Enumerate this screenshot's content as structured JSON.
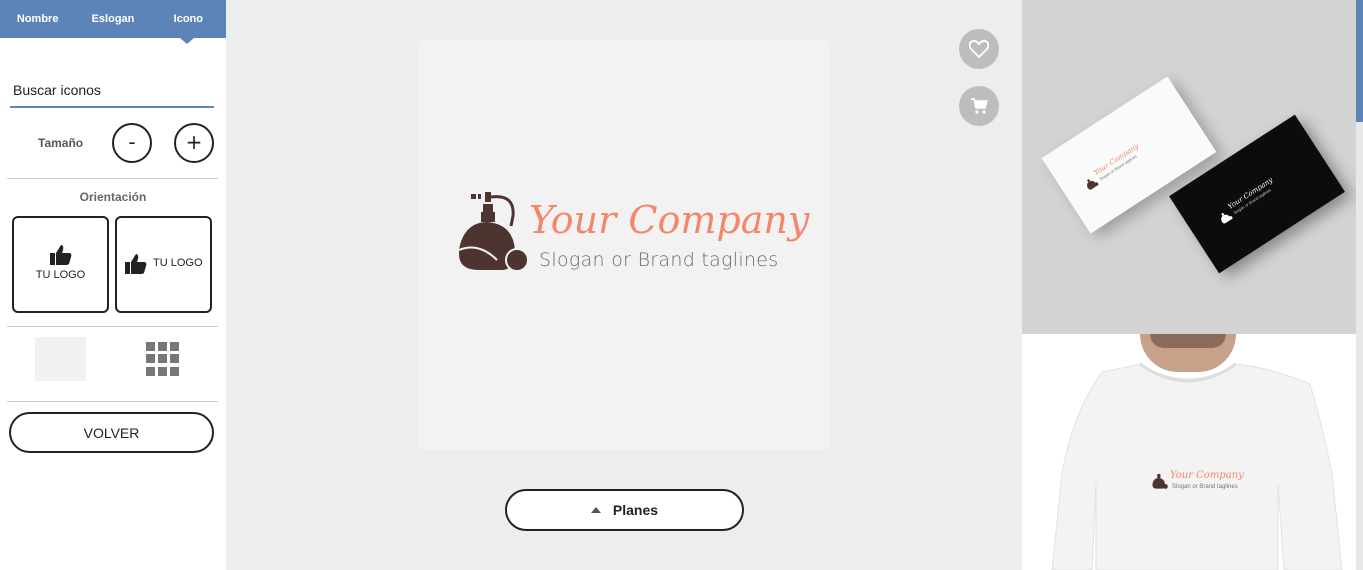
{
  "tabs": [
    {
      "label": "Nombre"
    },
    {
      "label": "Eslogan"
    },
    {
      "label": "Icono"
    }
  ],
  "search": {
    "placeholder": "Buscar iconos"
  },
  "size": {
    "label": "Tamaño",
    "decrease": "-",
    "increase": "+"
  },
  "orientation": {
    "label": "Orientación",
    "vertical_text": "TU LOGO",
    "horizontal_text": "TU LOGO"
  },
  "back_button": "VOLVER",
  "logo": {
    "company": "Your Company",
    "slogan": "Slogan or Brand taglines",
    "company_color": "#f4876b",
    "icon_color": "#4e3430"
  },
  "plans_button": "Planes",
  "previews": {
    "card_company": "Your Company",
    "card_slogan": "Slogan or Brand taglines",
    "shirt_company": "Your Company",
    "shirt_slogan": "Slogan or Brand taglines"
  },
  "colors": {
    "accent": "#5d84b8",
    "background": "#ecedee"
  }
}
